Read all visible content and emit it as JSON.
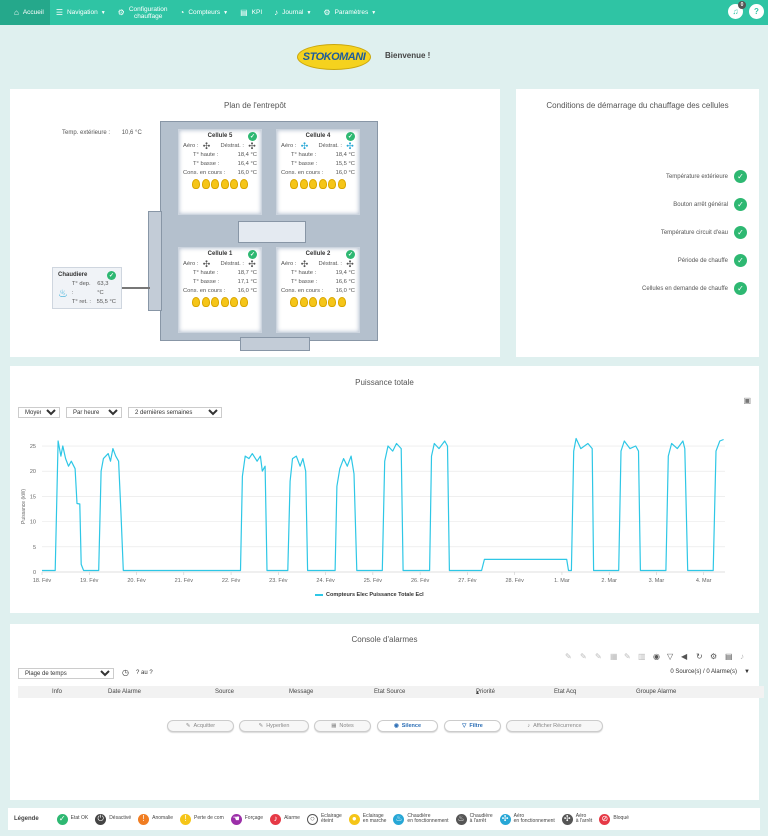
{
  "nav": {
    "home": "Accueil",
    "navigation": "Navigation",
    "config_line1": "Configuration",
    "config_line2": "chauffage",
    "meters": "Compteurs",
    "kpi": "KPI",
    "journal": "Journal",
    "settings": "Paramètres",
    "notif_count": "0",
    "help": "?"
  },
  "header": {
    "logo_text": "STOKOMANI",
    "welcome": "Bienvenue !"
  },
  "warehouse": {
    "title": "Plan de l'entrepôt",
    "ext_temp_label": "Temp. extérieure :",
    "ext_temp_value": "10,6 °C",
    "labels": {
      "aero": "Aéro :",
      "destrat": "Déstrat. :",
      "t_high": "T° haute :",
      "t_low": "T° basse :",
      "cons": "Cons. en cours :"
    },
    "cells": [
      {
        "name": "Cellule 5",
        "t_high": "18,4 °C",
        "t_low": "16,4 °C",
        "cons": "16,0 °C",
        "bulbs": 6
      },
      {
        "name": "Cellule 4",
        "t_high": "18,4 °C",
        "t_low": "15,5 °C",
        "cons": "16,0 °C",
        "bulbs": 6
      },
      {
        "name": "Cellule 1",
        "t_high": "18,7 °C",
        "t_low": "17,1 °C",
        "cons": "16,0 °C",
        "bulbs": 6
      },
      {
        "name": "Cellule 2",
        "t_high": "19,4 °C",
        "t_low": "16,6 °C",
        "cons": "16,0 °C",
        "bulbs": 6
      }
    ],
    "boiler": {
      "name": "Chaudiere",
      "dep_label": "T° dep. :",
      "dep_value": "63,3 °C",
      "ret_label": "T° ret. :",
      "ret_value": "55,5 °C"
    }
  },
  "conditions": {
    "title": "Conditions de démarrage du chauffage des cellules",
    "items": [
      "Température extérieure",
      "Bouton arrêt général",
      "Température circuit d'eau",
      "Période de chauffe",
      "Cellules en demande de chauffe"
    ]
  },
  "power": {
    "title": "Puissance totale",
    "selects": [
      "Moyenne",
      "Par heure",
      "2 dernières semaines"
    ]
  },
  "chart_data": {
    "type": "line",
    "title": "Puissance totale",
    "ylabel": "Puissance (kW)",
    "xlabel": "",
    "ylim": [
      0,
      26
    ],
    "yticks": [
      0,
      5,
      10,
      15,
      20,
      25
    ],
    "x_ticks": [
      "18. Fév",
      "19. Fév",
      "20. Fév",
      "21. Fév",
      "22. Fév",
      "23. Fév",
      "24. Fév",
      "25. Fév",
      "26. Fév",
      "27. Fév",
      "28. Fév",
      "1. Mar",
      "2. Mar",
      "3. Mar",
      "4. Mar"
    ],
    "x_start": 18.0,
    "x_end": 32.45,
    "grid": true,
    "series": [
      {
        "name": "Compteurs Elec Puissance Totale Ecl",
        "color": "#2ec7e6",
        "points": [
          [
            18.0,
            0.3
          ],
          [
            18.28,
            0.3
          ],
          [
            18.34,
            26
          ],
          [
            18.4,
            23
          ],
          [
            18.44,
            25
          ],
          [
            18.5,
            22.5
          ],
          [
            18.56,
            21
          ],
          [
            18.62,
            22
          ],
          [
            18.7,
            20.5
          ],
          [
            18.74,
            13.6
          ],
          [
            18.8,
            13.5
          ],
          [
            18.83,
            1.5
          ],
          [
            18.88,
            0.3
          ],
          [
            19.2,
            0.3
          ],
          [
            19.25,
            20
          ],
          [
            19.3,
            22.5
          ],
          [
            19.4,
            23.5
          ],
          [
            19.45,
            22
          ],
          [
            19.5,
            24.5
          ],
          [
            19.56,
            23
          ],
          [
            19.62,
            22
          ],
          [
            19.67,
            12
          ],
          [
            19.72,
            0.3
          ],
          [
            22.2,
            0.3
          ],
          [
            22.24,
            19
          ],
          [
            22.3,
            23
          ],
          [
            22.38,
            22.5
          ],
          [
            22.45,
            23.5
          ],
          [
            22.55,
            22
          ],
          [
            22.62,
            23
          ],
          [
            22.66,
            20
          ],
          [
            22.72,
            21
          ],
          [
            22.76,
            0.3
          ],
          [
            23.2,
            0.3
          ],
          [
            23.25,
            18
          ],
          [
            23.3,
            22.5
          ],
          [
            23.38,
            23
          ],
          [
            23.46,
            21
          ],
          [
            23.52,
            22.5
          ],
          [
            23.58,
            20
          ],
          [
            23.62,
            0.3
          ],
          [
            24.2,
            0.3
          ],
          [
            24.24,
            17
          ],
          [
            24.3,
            20.5
          ],
          [
            24.38,
            22.5
          ],
          [
            24.46,
            21
          ],
          [
            24.54,
            23
          ],
          [
            24.6,
            19.5
          ],
          [
            24.66,
            0.3
          ],
          [
            25.2,
            0.3
          ],
          [
            25.25,
            22
          ],
          [
            25.32,
            25
          ],
          [
            25.42,
            24
          ],
          [
            25.5,
            25.5
          ],
          [
            25.6,
            24.5
          ],
          [
            25.64,
            0.3
          ],
          [
            26.2,
            0.3
          ],
          [
            26.24,
            23
          ],
          [
            26.3,
            25.5
          ],
          [
            26.4,
            24.5
          ],
          [
            26.52,
            26
          ],
          [
            26.58,
            25
          ],
          [
            26.62,
            0.3
          ],
          [
            27.3,
            0.3
          ],
          [
            27.36,
            2.5
          ],
          [
            29.1,
            2.5
          ],
          [
            29.14,
            0.3
          ],
          [
            29.2,
            0.3
          ],
          [
            29.25,
            24
          ],
          [
            29.3,
            26.5
          ],
          [
            29.4,
            24.5
          ],
          [
            29.55,
            25.5
          ],
          [
            29.64,
            24.5
          ],
          [
            29.67,
            0.3
          ],
          [
            30.2,
            0.3
          ],
          [
            30.25,
            24
          ],
          [
            30.32,
            26
          ],
          [
            30.44,
            24.5
          ],
          [
            30.56,
            25
          ],
          [
            30.62,
            24
          ],
          [
            30.66,
            0.3
          ],
          [
            31.2,
            0.3
          ],
          [
            31.25,
            23
          ],
          [
            31.32,
            25.5
          ],
          [
            31.44,
            24.5
          ],
          [
            31.56,
            26
          ],
          [
            31.6,
            24.5
          ],
          [
            31.66,
            0.3
          ],
          [
            32.2,
            0.3
          ],
          [
            32.26,
            24
          ],
          [
            32.34,
            26
          ],
          [
            32.42,
            26.3
          ]
        ]
      }
    ]
  },
  "alarms": {
    "title": "Console d'alarmes",
    "time_range": "Plage de temps",
    "time_from_to": "? au ?",
    "sources_count": "0 Source(s) / 0 Alarme(s)",
    "columns": [
      "Info",
      "Date Alarme",
      "Source",
      "Message",
      "Etat Source",
      "Priorité",
      "Etat Acq",
      "Groupe Alarme"
    ],
    "buttons": [
      "Acquitter",
      "Hyperlien",
      "Notes",
      "Silence",
      "Filtre",
      "Afficher Récurrence"
    ]
  },
  "legend": {
    "title": "Légende",
    "items": [
      {
        "label1": "Etat OK",
        "label2": "",
        "color": "#2eb872",
        "icon": "check-icon"
      },
      {
        "label1": "Désactivé",
        "label2": "",
        "color": "#444444",
        "icon": "power-icon"
      },
      {
        "label1": "Anomalie",
        "label2": "",
        "color": "#f07d22",
        "icon": "warning-icon"
      },
      {
        "label1": "Perte de com",
        "label2": "",
        "color": "#f5c518",
        "icon": "exclamation-icon"
      },
      {
        "label1": "Forçage",
        "label2": "",
        "color": "#9b2fa8",
        "icon": "hand-icon"
      },
      {
        "label1": "Alarme",
        "label2": "",
        "color": "#e63946",
        "icon": "bell-icon"
      },
      {
        "label1": "Eclairage",
        "label2": "éteint",
        "color": "#ffffff",
        "icon": "bulb-off-icon"
      },
      {
        "label1": "Eclairage",
        "label2": "en marche",
        "color": "#f5c518",
        "icon": "bulb-on-icon"
      },
      {
        "label1": "Chaudière",
        "label2": "en fonctionnement",
        "color": "#27a7d6",
        "icon": "flame-icon"
      },
      {
        "label1": "Chaudière",
        "label2": "à l'arrêt",
        "color": "#555555",
        "icon": "flame-off-icon"
      },
      {
        "label1": "Aéro",
        "label2": "en fonctionnement",
        "color": "#27a7d6",
        "icon": "fan-icon"
      },
      {
        "label1": "Aéro",
        "label2": "à l'arrêt",
        "color": "#555555",
        "icon": "fan-off-icon"
      },
      {
        "label1": "Bloqué",
        "label2": "",
        "color": "#e63946",
        "icon": "blocked-icon"
      }
    ]
  }
}
